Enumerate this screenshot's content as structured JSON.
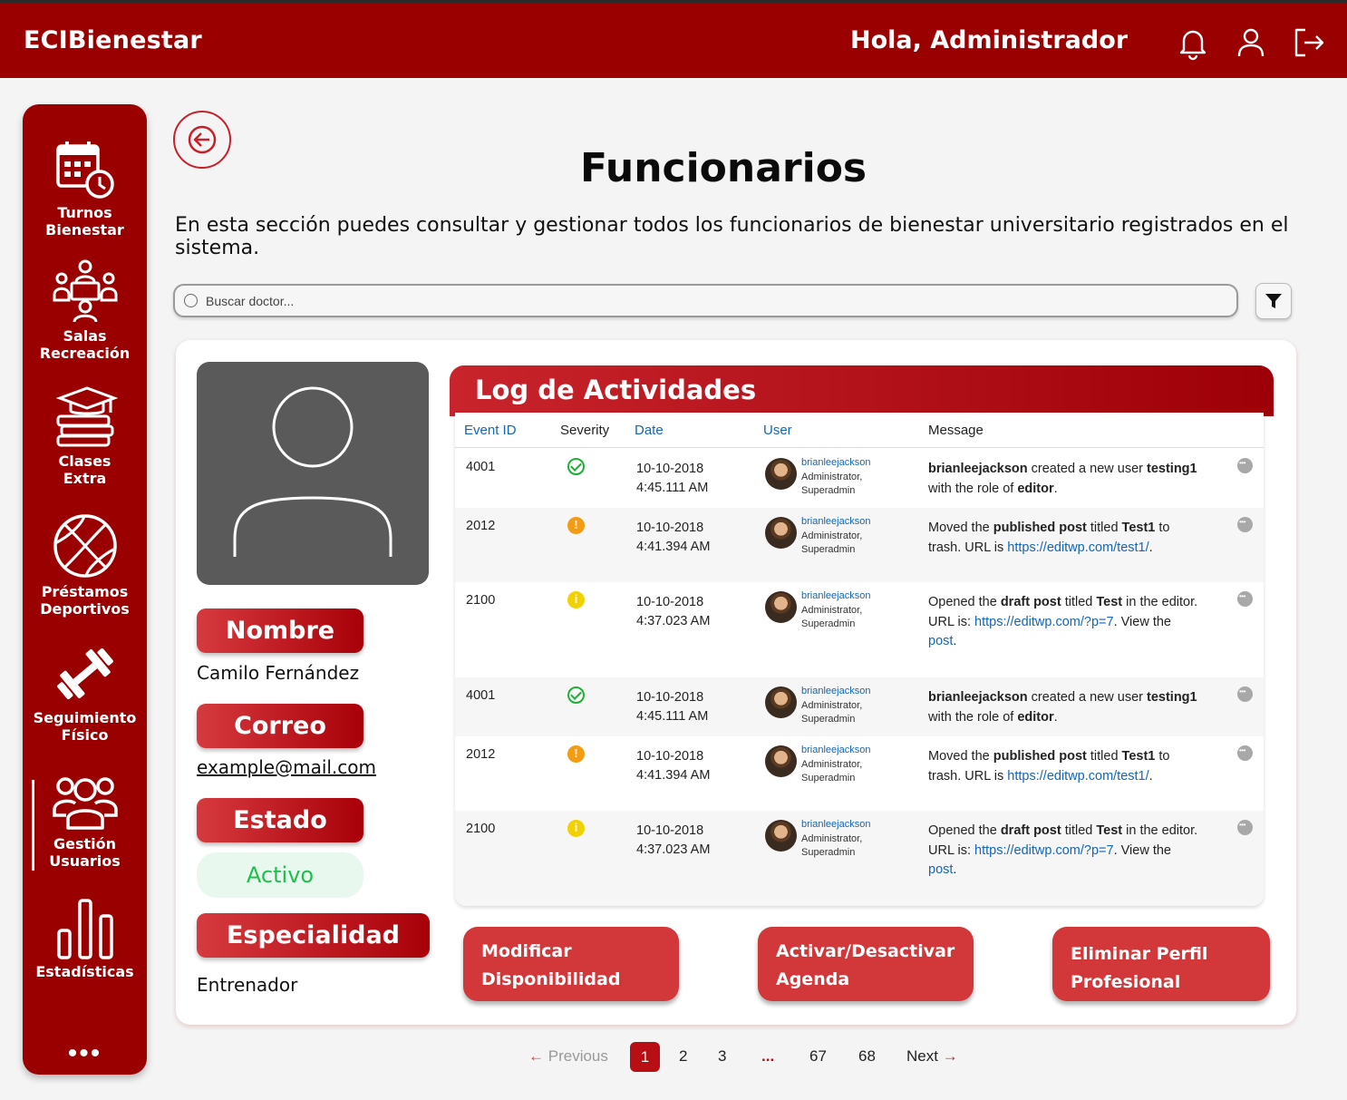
{
  "header": {
    "brand": "ECIBienestar",
    "greeting": "Hola, Administrador",
    "icons": [
      "bell-icon",
      "user-icon",
      "logout-icon"
    ]
  },
  "sidebar": {
    "items": [
      {
        "label1": "Turnos",
        "label2": "Bienestar",
        "icon": "calendar-clock-icon"
      },
      {
        "label1": "Salas",
        "label2": "Recreación",
        "icon": "meeting-room-icon"
      },
      {
        "label1": "Clases",
        "label2": "Extra",
        "icon": "graduation-books-icon"
      },
      {
        "label1": "Préstamos",
        "label2": "Deportivos",
        "icon": "basketball-icon"
      },
      {
        "label1": "Seguimiento",
        "label2": "Físico",
        "icon": "dumbbell-icon"
      },
      {
        "label1": "Gestión",
        "label2": "Usuarios",
        "icon": "users-group-icon"
      },
      {
        "label1": "Estadísticas",
        "label2": "",
        "icon": "bar-chart-icon"
      }
    ],
    "more": "•••",
    "active_index": 5
  },
  "page": {
    "title": "Funcionarios",
    "description": "En esta sección puedes consultar y gestionar todos los funcionarios de bienestar universitario registrados en el sistema."
  },
  "search": {
    "placeholder": "Buscar doctor..."
  },
  "profile": {
    "name_label": "Nombre",
    "name_value": "Camilo Fernández",
    "email_label": "Correo",
    "email_value": "example@mail.com",
    "status_label": "Estado",
    "status_value": "Activo",
    "specialty_label": "Especialidad",
    "specialty_value": "Entrenador"
  },
  "log": {
    "title": "Log  de Actividades",
    "columns": [
      "Event ID",
      "Severity",
      "Date",
      "User",
      "Message"
    ],
    "rows": [
      {
        "id": "4001",
        "severity": "success",
        "date1": "10-10-2018",
        "date2": "4:45.111 AM",
        "user": "brianleejackson",
        "role1": "Administrator,",
        "role2": "Superadmin",
        "msg": [
          [
            "b",
            "brianleejackson"
          ],
          [
            "t",
            " created a new user "
          ],
          [
            "b",
            "testing1"
          ],
          [
            "t",
            " with the role of "
          ],
          [
            "b",
            "editor"
          ],
          [
            "t",
            "."
          ]
        ]
      },
      {
        "id": "2012",
        "severity": "warning",
        "date1": "10-10-2018",
        "date2": "4:41.394 AM",
        "user": "brianleejackson",
        "role1": "Administrator,",
        "role2": "Superadmin",
        "msg": [
          [
            "t",
            "Moved the "
          ],
          [
            "b",
            "published post"
          ],
          [
            "t",
            " titled "
          ],
          [
            "b",
            "Test1"
          ],
          [
            "t",
            " to trash. URL is "
          ],
          [
            "a",
            "https://editwp.com/test1/"
          ],
          [
            "t",
            "."
          ]
        ]
      },
      {
        "id": "2100",
        "severity": "info",
        "date1": "10-10-2018",
        "date2": "4:37.023 AM",
        "user": "brianleejackson",
        "role1": "Administrator,",
        "role2": "Superadmin",
        "msg": [
          [
            "t",
            "Opened the "
          ],
          [
            "b",
            "draft post"
          ],
          [
            "t",
            " titled "
          ],
          [
            "b",
            "Test"
          ],
          [
            "t",
            " in the editor. URL is: "
          ],
          [
            "a",
            "https://editwp.com/?p=7"
          ],
          [
            "t",
            ". View the "
          ],
          [
            "a",
            "post"
          ],
          [
            "t",
            "."
          ]
        ]
      },
      {
        "id": "4001",
        "severity": "success",
        "date1": "10-10-2018",
        "date2": "4:45.111 AM",
        "user": "brianleejackson",
        "role1": "Administrator,",
        "role2": "Superadmin",
        "msg": [
          [
            "b",
            "brianleejackson"
          ],
          [
            "t",
            " created a new user "
          ],
          [
            "b",
            "testing1"
          ],
          [
            "t",
            " with the role of "
          ],
          [
            "b",
            "editor"
          ],
          [
            "t",
            "."
          ]
        ]
      },
      {
        "id": "2012",
        "severity": "warning",
        "date1": "10-10-2018",
        "date2": "4:41.394 AM",
        "user": "brianleejackson",
        "role1": "Administrator,",
        "role2": "Superadmin",
        "msg": [
          [
            "t",
            "Moved the "
          ],
          [
            "b",
            "published post"
          ],
          [
            "t",
            " titled "
          ],
          [
            "b",
            "Test1"
          ],
          [
            "t",
            " to trash. URL is "
          ],
          [
            "a",
            "https://editwp.com/test1/"
          ],
          [
            "t",
            "."
          ]
        ]
      },
      {
        "id": "2100",
        "severity": "info",
        "date1": "10-10-2018",
        "date2": "4:37.023 AM",
        "user": "brianleejackson",
        "role1": "Administrator,",
        "role2": "Superadmin",
        "msg": [
          [
            "t",
            "Opened the "
          ],
          [
            "b",
            "draft post"
          ],
          [
            "t",
            " titled "
          ],
          [
            "b",
            "Test"
          ],
          [
            "t",
            " in the editor. URL is: "
          ],
          [
            "a",
            "https://editwp.com/?p=7"
          ],
          [
            "t",
            ". View the "
          ],
          [
            "a",
            "post"
          ],
          [
            "t",
            "."
          ]
        ]
      }
    ]
  },
  "actions": {
    "modify_line1": "Modificar",
    "modify_line2": "Disponibilidad",
    "toggle_line1": "Activar/Desactivar",
    "toggle_line2": "Agenda",
    "delete_line1": "Eliminar Perfil",
    "delete_line2": "Profesional"
  },
  "pagination": {
    "previous": "Previous",
    "next": "Next",
    "pages": [
      "1",
      "2",
      "3",
      "...",
      "67",
      "68"
    ],
    "current": "1"
  },
  "colors": {
    "primary": "#9b0000",
    "accent": "#d2373a",
    "status_active": "#1ebf4c",
    "link": "#1366b8"
  }
}
